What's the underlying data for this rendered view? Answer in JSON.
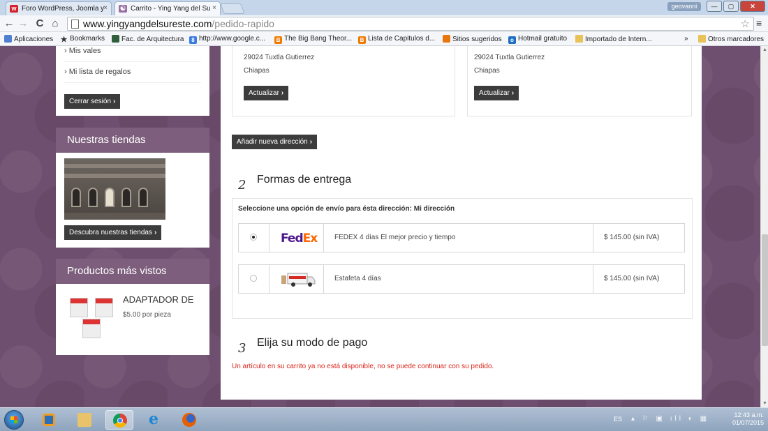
{
  "browser": {
    "tabs": [
      {
        "label": "Foro WordPress, Joomla y",
        "favicon": "wordpress-forum-icon",
        "close": "×"
      },
      {
        "label": "Carrito - Ying Yang del Su",
        "favicon": "yingyang-site-icon",
        "close": "×"
      }
    ],
    "user_badge": "geovanni",
    "window_buttons": {
      "minimize": "—",
      "maximize": "▢",
      "close": "✕"
    },
    "url_host": "www.yingyangdelsureste.com",
    "url_path": "/pedido-rapido",
    "nav": {
      "back": "←",
      "forward": "→",
      "reload": "C",
      "home": "⌂",
      "star": "☆",
      "menu": "≡"
    },
    "bookmarks": [
      {
        "label": "Aplicaciones",
        "icon": "apps-grid-icon"
      },
      {
        "label": "Bookmarks",
        "icon": "star-icon"
      },
      {
        "label": "Fac. de Arquitectura",
        "icon": "site-icon"
      },
      {
        "label": "http://www.google.c...",
        "icon": "google-icon"
      },
      {
        "label": "The Big Bang Theor...",
        "icon": "blogger-icon"
      },
      {
        "label": "Lista de Capitulos d...",
        "icon": "blogger-icon"
      },
      {
        "label": "Sitios sugeridos",
        "icon": "suggested-icon"
      },
      {
        "label": "Hotmail gratuito",
        "icon": "outlook-icon"
      },
      {
        "label": "Importado de Intern...",
        "icon": "folder-icon"
      },
      {
        "label": "»",
        "icon": ""
      },
      {
        "label": "Otros marcadores",
        "icon": "folder-icon"
      }
    ]
  },
  "sidebar": {
    "account_links": [
      "› Mis vales",
      "› Mi lista de regalos"
    ],
    "logout_button": "Cerrar sesión",
    "stores": {
      "title": "Nuestras tiendas",
      "button": "Descubra nuestras tiendas"
    },
    "viewed": {
      "title": "Productos más vistos",
      "product_name": "ADAPTADOR DE",
      "product_price": "$5.00 por pieza"
    }
  },
  "addresses": [
    {
      "line1": "29024 Tuxtla Gutierrez",
      "line2": "Chiapas",
      "button": "Actualizar"
    },
    {
      "line1": "29024 Tuxtla Gutierrez",
      "line2": "Chiapas",
      "button": "Actualizar"
    }
  ],
  "add_address_button": "Añadir nueva dirección",
  "step2": {
    "number": "2",
    "title": "Formas de entrega",
    "hint": "Seleccione una opción de envío para ésta dirección: Mi dirección",
    "options": [
      {
        "carrier_logo_a": "Fed",
        "carrier_logo_b": "Ex",
        "label": "FEDEX 4 días El mejor precio y tiempo",
        "price": "$ 145.00 (sin IVA)",
        "selected": true
      },
      {
        "carrier_logo": "estafeta-truck-icon",
        "label": "Estafeta 4 días",
        "price": "$ 145.00 (sin IVA)",
        "selected": false
      }
    ]
  },
  "step3": {
    "number": "3",
    "title": "Elija su modo de pago",
    "error": "Un artículo en su carrito ya no está disponible, no se puede continuar con su pedido."
  },
  "taskbar": {
    "language": "ES",
    "time": "12:43 a.m.",
    "date": "01/07/2015"
  }
}
